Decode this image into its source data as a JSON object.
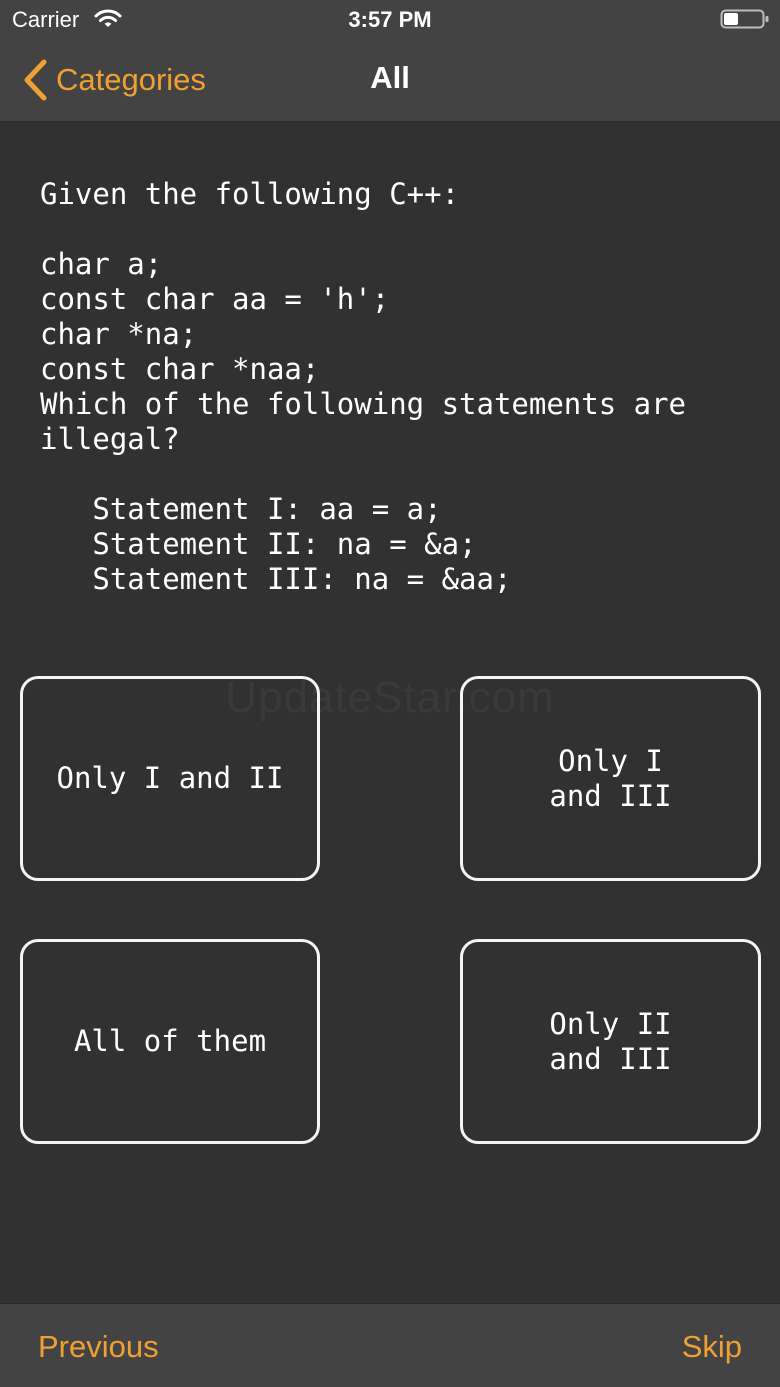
{
  "status_bar": {
    "carrier": "Carrier",
    "time": "3:57 PM",
    "wifi_icon": "wifi-icon",
    "battery_icon": "battery-icon"
  },
  "nav": {
    "back_label": "Categories",
    "back_icon": "chevron-left-icon",
    "title": "All"
  },
  "question": {
    "text": "Given the following C++:\n\nchar a;\nconst char aa = 'h';\nchar *na;\nconst char *naa;\nWhich of the following statements are\nillegal?\n\n   Statement I: aa = a;\n   Statement II: na = &a;\n   Statement III: na = &aa;"
  },
  "watermark": "UpdateStar.com",
  "answers": [
    {
      "label": "Only I and II"
    },
    {
      "label": "Only I and III"
    },
    {
      "label": "All of them"
    },
    {
      "label": "Only II and III"
    }
  ],
  "toolbar": {
    "previous_label": "Previous",
    "skip_label": "Skip"
  },
  "colors": {
    "accent": "#f0a033",
    "background": "#313131",
    "bar": "#434343",
    "border": "#f4f4f4"
  }
}
